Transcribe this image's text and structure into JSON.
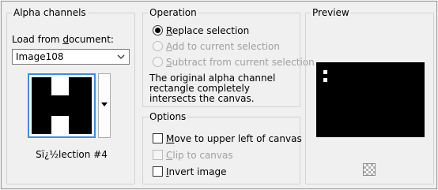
{
  "alpha_channels": {
    "title": "Alpha channels",
    "load_label_pre": "Load from ",
    "load_label_u": "d",
    "load_label_post": "ocument:",
    "document_value": "Image108",
    "selection_name": "Sï¿½lection #4"
  },
  "operation": {
    "title": "Operation",
    "options": [
      {
        "u": "R",
        "rest": "eplace selection",
        "selected": true,
        "enabled": true
      },
      {
        "u": "A",
        "rest": "dd to current selection",
        "selected": false,
        "enabled": false
      },
      {
        "u": "S",
        "rest": "ubtract from current selection",
        "selected": false,
        "enabled": false
      }
    ],
    "description": "The original alpha channel rectangle completely intersects the canvas."
  },
  "options": {
    "title": "Options",
    "move": {
      "u": "M",
      "rest": "ove to upper left of canvas",
      "checked": false,
      "enabled": true
    },
    "clip": {
      "u": "C",
      "rest": "lip to canvas",
      "checked": false,
      "enabled": false
    },
    "invert": {
      "u": "I",
      "rest": "nvert image",
      "checked": false,
      "enabled": true
    }
  },
  "preview": {
    "title": "Preview",
    "zoom_icon": "transparency-checker-icon"
  }
}
